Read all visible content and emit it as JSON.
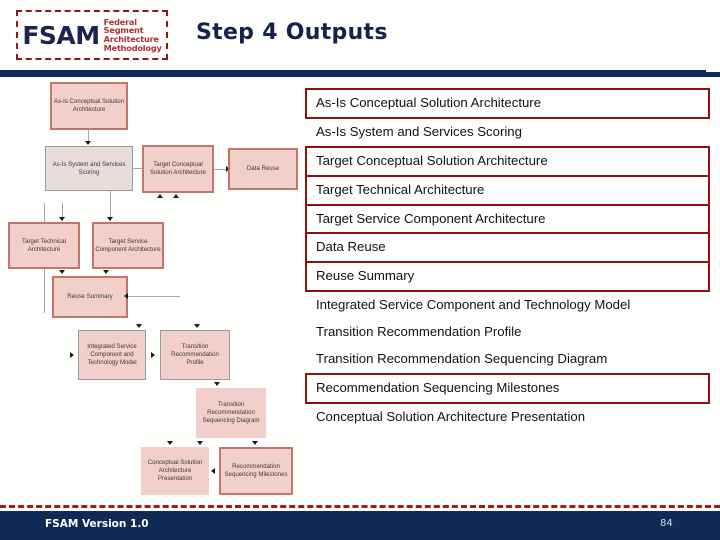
{
  "header": {
    "title": "Step 4 Outputs",
    "logo": {
      "acronym": "FSAM",
      "line1": "Federal",
      "line2": "Segment",
      "line3": "Architecture",
      "line4": "Methodology"
    }
  },
  "colors": {
    "navy": "#102a56",
    "accent_red": "#8d1111",
    "box_fill": "#f2cfcb",
    "box_border_highlight": "#c4756c",
    "logo_red": "#b03030",
    "logo_navy": "#1b2452"
  },
  "diagram": {
    "nodes": [
      {
        "id": "as-is-conceptual-solution-architecture",
        "label": "As-Is Conceptual Solution Architecture",
        "style": "hl"
      },
      {
        "id": "as-is-system-and-services-scoring",
        "label": "As-Is System and Services Scoring",
        "style": "gray"
      },
      {
        "id": "target-conceptual-solution-architecture",
        "label": "Target Conceptual Solution Architecture",
        "style": "hl"
      },
      {
        "id": "data-reuse",
        "label": "Data Reuse",
        "style": "hl"
      },
      {
        "id": "target-technical-architecture",
        "label": "Target Technical Architecture",
        "style": "hl"
      },
      {
        "id": "target-service-component-architecture",
        "label": "Target Service Component Architecture",
        "style": "hl"
      },
      {
        "id": "reuse-summary",
        "label": "Reuse Summary",
        "style": "hl"
      },
      {
        "id": "integrated-service-component-and-technology-model",
        "label": "Integrated Service Component and Technology Model",
        "style": "plain"
      },
      {
        "id": "transition-recommendation-profile",
        "label": "Transition Recommendation Profile",
        "style": "plain"
      },
      {
        "id": "transition-recommendation-sequencing-diagram",
        "label": "Transition Recommendation Sequencing Diagram",
        "style": "nob"
      },
      {
        "id": "conceptual-solution-architecture-presentation",
        "label": "Conceptual Solution Architecture Presentation",
        "style": "nob"
      },
      {
        "id": "recommendation-sequencing-milestones",
        "label": "Recommendation Sequencing Milestones",
        "style": "hl"
      }
    ]
  },
  "outputs": {
    "items": [
      {
        "label": "As-Is Conceptual Solution Architecture",
        "box": "boxed"
      },
      {
        "label": "As-Is System and Services Scoring",
        "box": "plain"
      },
      {
        "label": "Target Conceptual Solution Architecture",
        "box": "boxed-top"
      },
      {
        "label": "Target Technical Architecture",
        "box": "boxed-mid"
      },
      {
        "label": "Target Service Component Architecture",
        "box": "boxed-mid"
      },
      {
        "label": "Data Reuse",
        "box": "boxed-mid"
      },
      {
        "label": "Reuse Summary",
        "box": "boxed-bottom"
      },
      {
        "label": "Integrated Service Component and Technology Model",
        "box": "plain"
      },
      {
        "label": "Transition Recommendation Profile",
        "box": "plain"
      },
      {
        "label": "Transition Recommendation Sequencing Diagram",
        "box": "plain"
      },
      {
        "label": "Recommendation Sequencing Milestones",
        "box": "boxed"
      },
      {
        "label": "Conceptual Solution Architecture Presentation",
        "box": "plain"
      }
    ]
  },
  "footer": {
    "version": "FSAM Version 1.0",
    "page_number": "84"
  }
}
